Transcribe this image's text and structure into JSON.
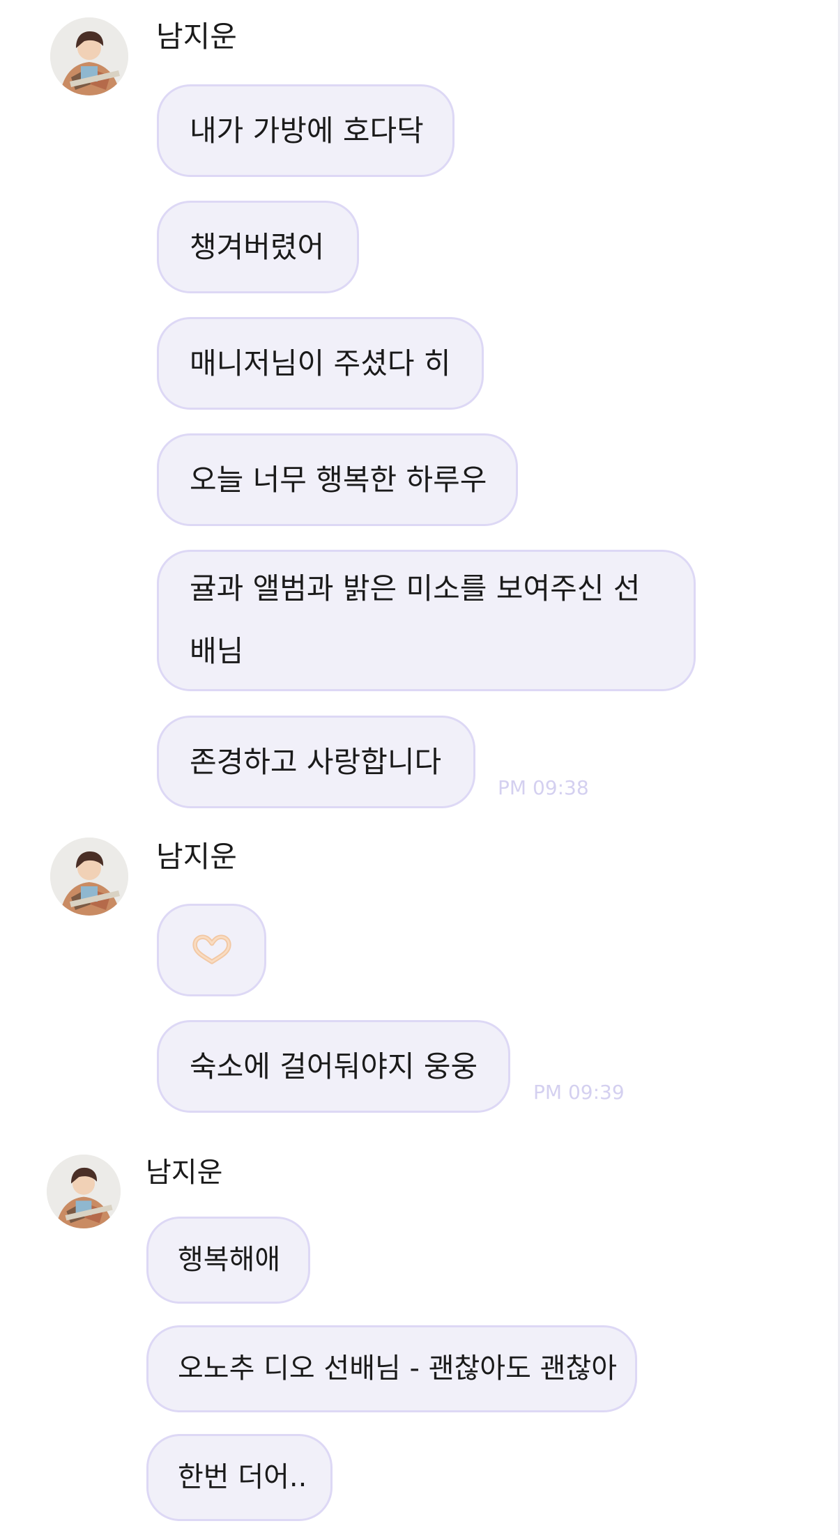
{
  "groups": [
    {
      "sender": "남지운",
      "messages": [
        "내가 가방에 호다닥",
        "챙겨버렸어",
        "매니저님이 주셨다 히",
        "오늘 너무 행복한 하루우",
        "귤과 앨범과 밝은 미소를 보여주신 선배님",
        "존경하고 사랑합니다"
      ],
      "time": "PM 09:38"
    },
    {
      "sender": "남지운",
      "messages": [
        "heart-hands-emoji",
        "숙소에 걸어둬야지 웅웅"
      ],
      "time": "PM 09:39"
    },
    {
      "sender": "남지운",
      "messages": [
        "행복해애",
        "오노추 디오 선배님 - 괜찮아도 괜찮아",
        "한번 더어.."
      ]
    }
  ],
  "colors": {
    "bubble_bg": "#f1f0f9",
    "bubble_border": "#ddd8f5",
    "timestamp": "#d4d0f0",
    "emoji_skin": "#f6d7b6"
  },
  "icons": {
    "avatar": "avatar",
    "emoji": "heart-hands-emoji"
  }
}
